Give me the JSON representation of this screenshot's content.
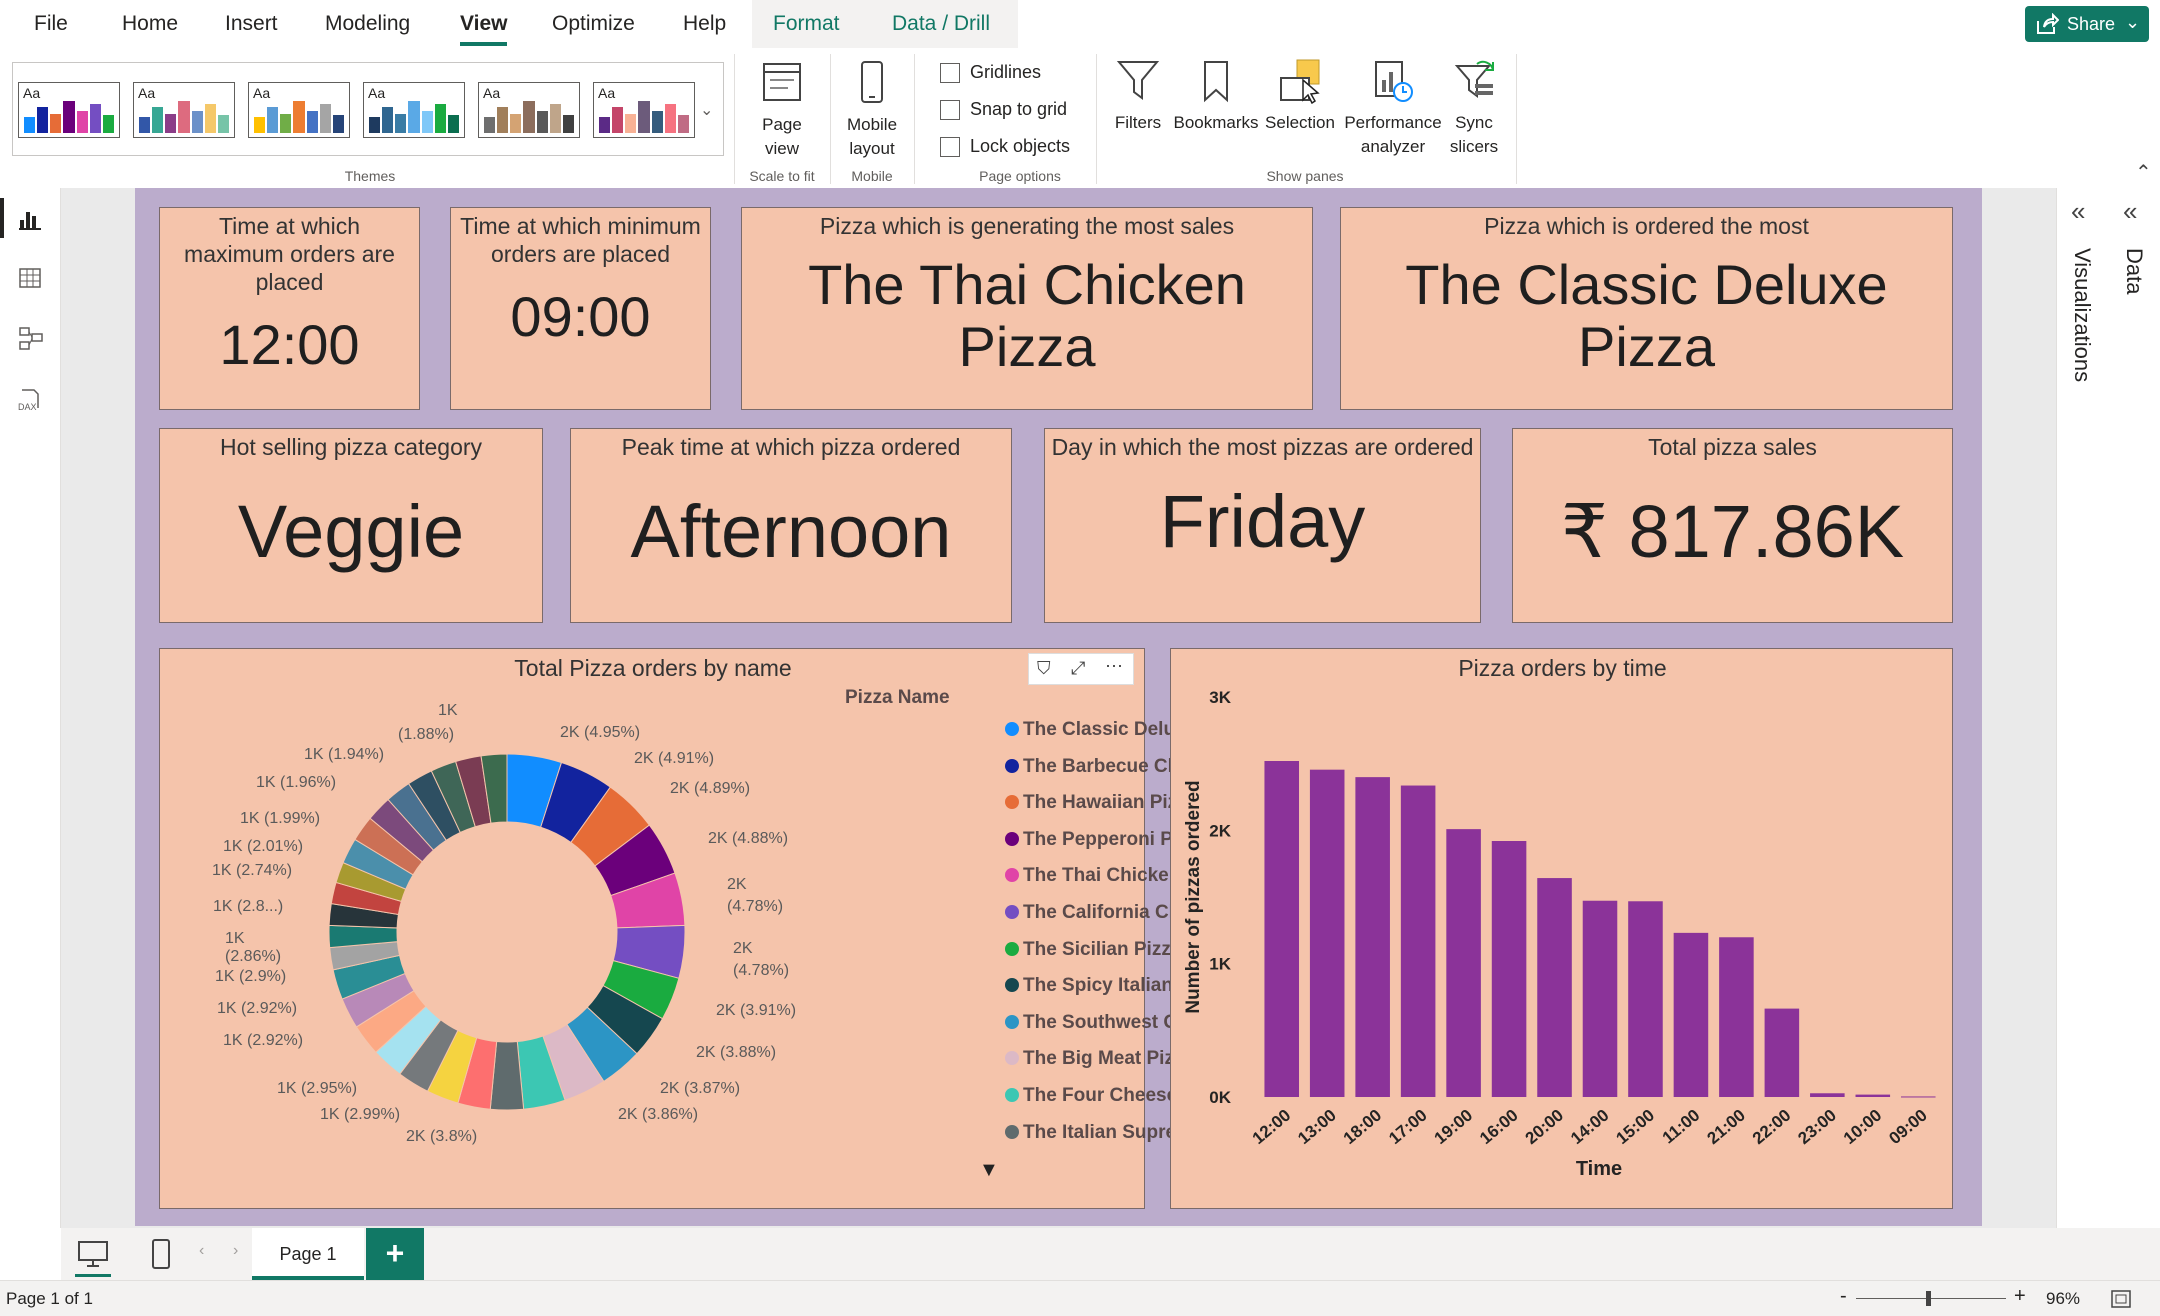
{
  "menu": {
    "items": [
      "File",
      "Home",
      "Insert",
      "Modeling",
      "View",
      "Optimize",
      "Help"
    ],
    "active": "View",
    "context_tabs": [
      "Format",
      "Data / Drill"
    ],
    "share_label": "Share"
  },
  "ribbon": {
    "themes_label": "Themes",
    "theme_aa": "Aa",
    "page_view_label": "Page view",
    "scale_to_fit_label": "Scale to fit",
    "mobile_layout_label": "Mobile layout",
    "mobile_label": "Mobile",
    "gridlines_label": "Gridlines",
    "snap_to_grid_label": "Snap to grid",
    "lock_objects_label": "Lock objects",
    "page_options_label": "Page options",
    "filters_label": "Filters",
    "bookmarks_label": "Bookmarks",
    "selection_label": "Selection",
    "performance_analyzer_label": "Performance analyzer",
    "sync_slicers_label": "Sync slicers",
    "show_panes_label": "Show panes"
  },
  "cards": {
    "max_orders": {
      "title": "Time at which maximum orders are placed",
      "value": "12:00"
    },
    "min_orders": {
      "title": "Time at which minimum orders are placed",
      "value": "09:00"
    },
    "most_sales": {
      "title": "Pizza which is generating the most sales",
      "value": "The Thai Chicken Pizza"
    },
    "most_ordered": {
      "title": "Pizza which is ordered the most",
      "value": "The Classic Deluxe Pizza"
    },
    "hot_category": {
      "title": "Hot selling pizza category",
      "value": "Veggie"
    },
    "peak_time": {
      "title": "Peak time at which pizza ordered",
      "value": "Afternoon"
    },
    "top_day": {
      "title": "Day in which the most pizzas are ordered",
      "value": "Friday"
    },
    "total_sales": {
      "title": "Total pizza sales",
      "value": "₹ 817.86K"
    }
  },
  "donut": {
    "title": "Total Pizza orders by name",
    "legend_title": "Pizza Name",
    "legend": [
      {
        "name": "The Classic Deluxe Pizza",
        "color": "#118dff"
      },
      {
        "name": "The Barbecue Chicken Pizza",
        "color": "#12239e"
      },
      {
        "name": "The Hawaiian Pizza",
        "color": "#e66c37"
      },
      {
        "name": "The Pepperoni Pizza",
        "color": "#6b007b"
      },
      {
        "name": "The Thai Chicken Pizza",
        "color": "#e044a7"
      },
      {
        "name": "The California Chicken Pizza",
        "color": "#744ec2"
      },
      {
        "name": "The Sicilian Pizza",
        "color": "#1aab40"
      },
      {
        "name": "The Spicy Italian Pizza",
        "color": "#15474f"
      },
      {
        "name": "The Southwest Chicken Pi...",
        "color": "#2c95c5"
      },
      {
        "name": "The Big Meat Pizza",
        "color": "#dcb9c6"
      },
      {
        "name": "The Four Cheese Pizza",
        "color": "#3cc7b3"
      },
      {
        "name": "The Italian Supreme Pizza",
        "color": "#5f6b6d"
      }
    ],
    "labels": [
      "2K (4.95%)",
      "2K (4.91%)",
      "2K (4.89%)",
      "2K (4.88%)",
      "2K",
      "(4.78%)",
      "2K",
      "(4.78%)",
      "2K (3.91%)",
      "2K (3.88%)",
      "2K (3.87%)",
      "2K (3.86%)",
      "2K (3.8%)",
      "1K (2.99%)",
      "1K (2.95%)",
      "1K (2.92%)",
      "1K (2.92%)",
      "1K (2.9%)",
      "1K",
      "(2.86%)",
      "1K (2.8...)",
      "1K (2.74%)",
      "1K (2.01%)",
      "1K (1.99%)",
      "1K (1.96%)",
      "1K (1.94%)",
      "1K",
      "(1.88%)"
    ]
  },
  "chart_data": {
    "type": "bar",
    "title": "Pizza orders by time",
    "xlabel": "Time",
    "ylabel": "Number of pizzas ordered",
    "categories": [
      "12:00",
      "13:00",
      "18:00",
      "17:00",
      "19:00",
      "16:00",
      "20:00",
      "14:00",
      "15:00",
      "11:00",
      "21:00",
      "22:00",
      "23:00",
      "10:00",
      "09:00"
    ],
    "values": [
      2520,
      2455,
      2399,
      2336,
      2009,
      1920,
      1642,
      1472,
      1468,
      1231,
      1198,
      663,
      28,
      18,
      4
    ],
    "ylim": [
      0,
      3000
    ],
    "yticks": [
      "0K",
      "1K",
      "2K",
      "3K"
    ],
    "bar_color": "#8b3399"
  },
  "donut_chart_data": {
    "type": "pie",
    "title": "Total Pizza orders by name",
    "values": [
      4.95,
      4.91,
      4.89,
      4.88,
      4.78,
      4.78,
      3.91,
      3.88,
      3.87,
      3.86,
      3.8,
      2.99,
      2.95,
      2.92,
      2.92,
      2.9,
      2.86,
      2.8,
      2.74,
      2.01,
      1.99,
      1.96,
      1.94,
      1.88
    ],
    "colors": [
      "#118dff",
      "#12239e",
      "#e66c37",
      "#6b007b",
      "#e044a7",
      "#744ec2",
      "#1aab40",
      "#15474f",
      "#2c95c5",
      "#dcb9c6",
      "#3cc7b3",
      "#5f6b6d",
      "#fd6f6f",
      "#f5d340",
      "#75797c",
      "#a5e2f0",
      "#fca984",
      "#b889b8",
      "#2a8e95",
      "#a3a3a3",
      "#1a7a72",
      "#27343a",
      "#c2443f",
      "#a89a30"
    ],
    "extra_colors": [
      "#4b8fab",
      "#cc7055",
      "#7c4a7c",
      "#4a7190",
      "#2e4f62",
      "#3f6657",
      "#7a3c53",
      "#3c6b4e"
    ]
  },
  "status": {
    "page_info": "Page 1 of 1",
    "zoom": "96%",
    "page_tab": "Page 1"
  },
  "panes": {
    "visualizations": "Visualizations",
    "data": "Data"
  }
}
